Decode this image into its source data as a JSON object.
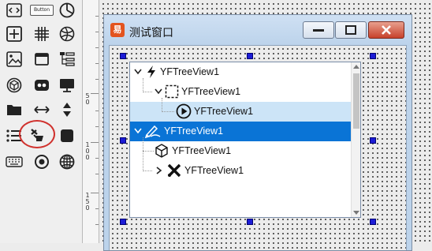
{
  "toolbox": {
    "icons": [
      "code-icon",
      "button-icon",
      "pie-chart-icon",
      "plus-box-icon",
      "grid-icon",
      "globe-icon",
      "image-icon",
      "window-icon",
      "list-tree-icon",
      "cube-icon",
      "dots-icon",
      "monitor-icon",
      "folder-icon",
      "horizontal-arrows-icon",
      "vertical-arrows-icon",
      "list-icon",
      "tree-view-icon",
      "square-icon",
      "keyboard-icon",
      "radio-icon",
      "globe-icon"
    ],
    "button_label": "Button",
    "selected_tool": "tree-view-icon"
  },
  "ruler": {
    "labels": [
      "50",
      "100",
      "150"
    ]
  },
  "form": {
    "title": "测试窗口",
    "app_icon_glyph": "易"
  },
  "tree": {
    "nodes": [
      {
        "label": "YFTreeView1",
        "icon": "lightning-icon",
        "level": 0,
        "expander": "expanded"
      },
      {
        "label": "YFTreeView1",
        "icon": "dashed-square-icon",
        "level": 1,
        "expander": "expanded"
      },
      {
        "label": "YFTreeView1",
        "icon": "play-circle-icon",
        "level": 2,
        "expander": "none"
      },
      {
        "label": "YFTreeView1",
        "icon": "pen-icon",
        "level": 0,
        "expander": "expanded",
        "selected": true
      },
      {
        "label": "YFTreeView1",
        "icon": "box-icon",
        "level": 1,
        "expander": "none"
      },
      {
        "label": "YFTreeView1",
        "icon": "x-mark-icon",
        "level": 1,
        "expander": "collapsed"
      }
    ]
  },
  "colors": {
    "selection": "#0a74d6",
    "hover": "#cce4f7",
    "handle": "#1b1bd6",
    "close_button": "#c7412b",
    "tool_highlight": "#d0312d"
  }
}
